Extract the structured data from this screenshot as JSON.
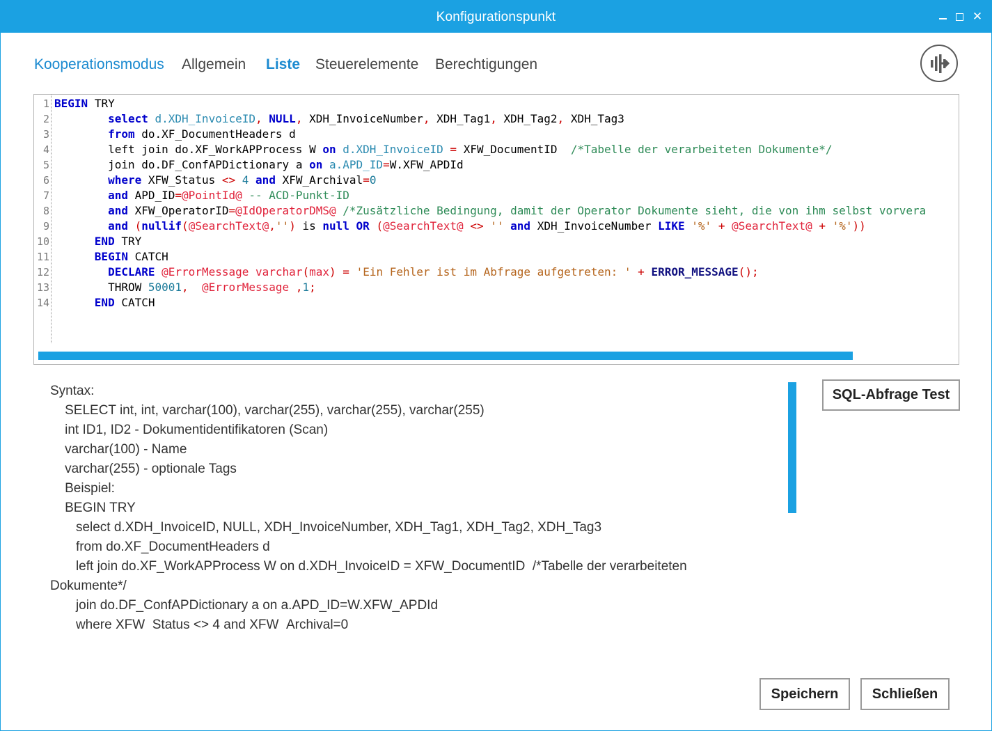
{
  "window": {
    "title": "Konfigurationspunkt",
    "controls": {
      "minimize": "minimize-icon",
      "maximize": "maximize-icon",
      "close": "✕"
    }
  },
  "tabs": [
    "Kooperationsmodus",
    "Allgemein",
    "Liste",
    "Steuerelemente",
    "Berechtigungen"
  ],
  "active_tab": "Liste",
  "logo_icon": "logo-icon",
  "colors": {
    "accent": "#1ba1e2",
    "tab_accent": "#1b8ad0"
  },
  "editor": {
    "line_numbers": [
      "1",
      "2",
      "3",
      "4",
      "5",
      "6",
      "7",
      "8",
      "9",
      "10",
      "11",
      "12",
      "13",
      "14"
    ],
    "lines": [
      "BEGIN TRY",
      "        select d.XDH_InvoiceID, NULL, XDH_InvoiceNumber, XDH_Tag1, XDH_Tag2, XDH_Tag3",
      "        from do.XF_DocumentHeaders d",
      "        left join do.XF_WorkAPProcess W on d.XDH_InvoiceID = XFW_DocumentID  /*Tabelle der verarbeiteten Dokumente*/",
      "        join do.DF_ConfAPDictionary a on a.APD_ID=W.XFW_APDId",
      "        where XFW_Status <> 4 and XFW_Archival=0",
      "        and APD_ID=@PointId@ -- ACD-Punkt-ID",
      "        and XFW_OperatorID=@IdOperatorDMS@ /*Zusätzliche Bedingung, damit der Operator Dokumente sieht, die von ihm selbst vorvera",
      "        and (nullif(@SearchText@,'') is null OR (@SearchText@ <> '' and XDH_InvoiceNumber LIKE '%' + @SearchText@ + '%'))",
      "      END TRY",
      "      BEGIN CATCH",
      "        DECLARE @ErrorMessage varchar(max) = 'Ein Fehler ist im Abfrage aufgetreten: ' + ERROR_MESSAGE();",
      "        THROW 50001,  @ErrorMessage ,1;",
      "      END CATCH"
    ]
  },
  "syntax_help": [
    "Syntax:",
    "    SELECT int, int, varchar(100), varchar(255), varchar(255), varchar(255)",
    "    int ID1, ID2 - Dokumentidentifikatoren (Scan)",
    "    varchar(100) - Name",
    "    varchar(255) - optionale Tags",
    "    Beispiel:",
    "    BEGIN TRY",
    "       select d.XDH_InvoiceID, NULL, XDH_InvoiceNumber, XDH_Tag1, XDH_Tag2, XDH_Tag3",
    "       from do.XF_DocumentHeaders d",
    "       left join do.XF_WorkAPProcess W on d.XDH_InvoiceID = XFW_DocumentID  /*Tabelle der verarbeiteten",
    "Dokumente*/",
    "       join do.DF_ConfAPDictionary a on a.APD_ID=W.XFW_APDId",
    "       where XFW_Status <> 4 and XFW_Archival=0"
  ],
  "buttons": {
    "sql_test": "SQL-Abfrage Test",
    "save": "Speichern",
    "close": "Schließen"
  }
}
